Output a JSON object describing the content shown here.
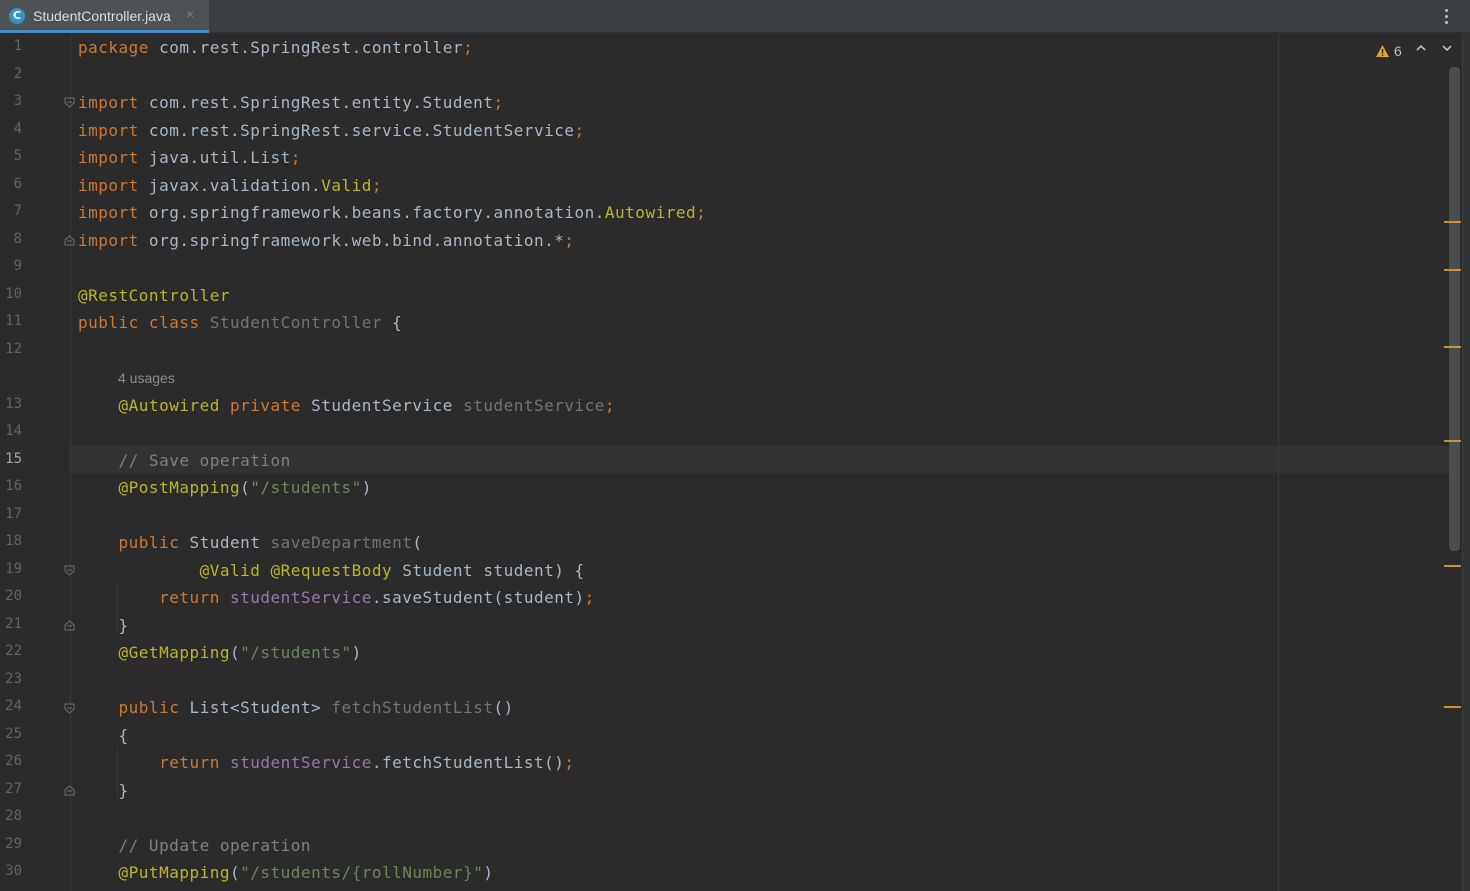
{
  "tab": {
    "title": "StudentController.java",
    "icon_letter": "C",
    "close_glyph": "×"
  },
  "inspections": {
    "warning_count": "6"
  },
  "editor": {
    "current_line": 15,
    "usage_hint": "4 usages",
    "lines": [
      {
        "n": "1",
        "tokens": [
          {
            "t": "package",
            "c": "kw"
          },
          {
            "t": " com.rest.SpringRest.controller",
            "c": "pl"
          },
          {
            "t": ";",
            "c": "kw"
          }
        ]
      },
      {
        "n": "2",
        "tokens": []
      },
      {
        "n": "3",
        "tokens": [
          {
            "t": "import",
            "c": "kw"
          },
          {
            "t": " com.rest.SpringRest.entity.Student",
            "c": "pl"
          },
          {
            "t": ";",
            "c": "kw"
          }
        ]
      },
      {
        "n": "4",
        "tokens": [
          {
            "t": "import",
            "c": "kw"
          },
          {
            "t": " com.rest.SpringRest.service.StudentService",
            "c": "pl"
          },
          {
            "t": ";",
            "c": "kw"
          }
        ]
      },
      {
        "n": "5",
        "tokens": [
          {
            "t": "import",
            "c": "kw"
          },
          {
            "t": " java.util.List",
            "c": "pl"
          },
          {
            "t": ";",
            "c": "kw"
          }
        ]
      },
      {
        "n": "6",
        "tokens": [
          {
            "t": "import",
            "c": "kw"
          },
          {
            "t": " javax.validation.",
            "c": "pl"
          },
          {
            "t": "Valid",
            "c": "ann"
          },
          {
            "t": ";",
            "c": "kw"
          }
        ]
      },
      {
        "n": "7",
        "tokens": [
          {
            "t": "import",
            "c": "kw"
          },
          {
            "t": " org.springframework.beans.factory.annotation.",
            "c": "pl"
          },
          {
            "t": "Autowired",
            "c": "ann"
          },
          {
            "t": ";",
            "c": "kw"
          }
        ]
      },
      {
        "n": "8",
        "tokens": [
          {
            "t": "import",
            "c": "kw"
          },
          {
            "t": " org.springframework.web.bind.annotation.*",
            "c": "pl"
          },
          {
            "t": ";",
            "c": "kw"
          }
        ]
      },
      {
        "n": "9",
        "tokens": []
      },
      {
        "n": "10",
        "tokens": [
          {
            "t": "@RestController",
            "c": "ann"
          }
        ]
      },
      {
        "n": "11",
        "tokens": [
          {
            "t": "public class ",
            "c": "kw"
          },
          {
            "t": "StudentController",
            "c": "unused"
          },
          {
            "t": " {",
            "c": "pl"
          }
        ]
      },
      {
        "n": "12",
        "tokens": []
      },
      {
        "n": "13",
        "tokens": [
          {
            "t": "    ",
            "c": "pl"
          },
          {
            "t": "@Autowired",
            "c": "ann"
          },
          {
            "t": " ",
            "c": "pl"
          },
          {
            "t": "private",
            "c": "kw"
          },
          {
            "t": " StudentService ",
            "c": "pl"
          },
          {
            "t": "studentService",
            "c": "unused"
          },
          {
            "t": ";",
            "c": "kw"
          }
        ]
      },
      {
        "n": "14",
        "tokens": []
      },
      {
        "n": "15",
        "tokens": [
          {
            "t": "    ",
            "c": "pl"
          },
          {
            "t": "// Save operation",
            "c": "com"
          }
        ]
      },
      {
        "n": "16",
        "tokens": [
          {
            "t": "    ",
            "c": "pl"
          },
          {
            "t": "@PostMapping",
            "c": "ann"
          },
          {
            "t": "(",
            "c": "pl"
          },
          {
            "t": "\"/students\"",
            "c": "str"
          },
          {
            "t": ")",
            "c": "pl"
          }
        ]
      },
      {
        "n": "17",
        "tokens": []
      },
      {
        "n": "18",
        "tokens": [
          {
            "t": "    ",
            "c": "pl"
          },
          {
            "t": "public",
            "c": "kw"
          },
          {
            "t": " Student ",
            "c": "pl"
          },
          {
            "t": "saveDepartment",
            "c": "unused"
          },
          {
            "t": "(",
            "c": "pl"
          }
        ]
      },
      {
        "n": "19",
        "tokens": [
          {
            "t": "            ",
            "c": "pl"
          },
          {
            "t": "@Valid",
            "c": "ann"
          },
          {
            "t": " ",
            "c": "pl"
          },
          {
            "t": "@RequestBody",
            "c": "ann"
          },
          {
            "t": " Student student) {",
            "c": "pl"
          }
        ]
      },
      {
        "n": "20",
        "tokens": [
          {
            "t": "        ",
            "c": "pl"
          },
          {
            "t": "return",
            "c": "kw"
          },
          {
            "t": " ",
            "c": "pl"
          },
          {
            "t": "studentService",
            "c": "fld"
          },
          {
            "t": ".saveStudent(student)",
            "c": "pl"
          },
          {
            "t": ";",
            "c": "kw"
          }
        ]
      },
      {
        "n": "21",
        "tokens": [
          {
            "t": "    }",
            "c": "pl"
          }
        ]
      },
      {
        "n": "22",
        "tokens": [
          {
            "t": "    ",
            "c": "pl"
          },
          {
            "t": "@GetMapping",
            "c": "ann"
          },
          {
            "t": "(",
            "c": "pl"
          },
          {
            "t": "\"/students\"",
            "c": "str"
          },
          {
            "t": ")",
            "c": "pl"
          }
        ]
      },
      {
        "n": "23",
        "tokens": []
      },
      {
        "n": "24",
        "tokens": [
          {
            "t": "    ",
            "c": "pl"
          },
          {
            "t": "public",
            "c": "kw"
          },
          {
            "t": " List<Student> ",
            "c": "pl"
          },
          {
            "t": "fetchStudentList",
            "c": "unused"
          },
          {
            "t": "()",
            "c": "pl"
          }
        ]
      },
      {
        "n": "25",
        "tokens": [
          {
            "t": "    {",
            "c": "pl"
          }
        ]
      },
      {
        "n": "26",
        "tokens": [
          {
            "t": "        ",
            "c": "pl"
          },
          {
            "t": "return",
            "c": "kw"
          },
          {
            "t": " ",
            "c": "pl"
          },
          {
            "t": "studentService",
            "c": "fld"
          },
          {
            "t": ".fetchStudentList()",
            "c": "pl"
          },
          {
            "t": ";",
            "c": "kw"
          }
        ]
      },
      {
        "n": "27",
        "tokens": [
          {
            "t": "    }",
            "c": "pl"
          }
        ]
      },
      {
        "n": "28",
        "tokens": []
      },
      {
        "n": "29",
        "tokens": [
          {
            "t": "    ",
            "c": "pl"
          },
          {
            "t": "// Update operation",
            "c": "com"
          }
        ]
      },
      {
        "n": "30",
        "tokens": [
          {
            "t": "    ",
            "c": "pl"
          },
          {
            "t": "@PutMapping",
            "c": "ann"
          },
          {
            "t": "(",
            "c": "pl"
          },
          {
            "t": "\"/students/{rollNumber}\"",
            "c": "str"
          },
          {
            "t": ")",
            "c": "pl"
          }
        ]
      }
    ]
  },
  "colors": {
    "background": "#2b2b2b",
    "keyword": "#cc7832",
    "annotation": "#bbb529",
    "string": "#6a8759",
    "comment": "#808080",
    "field": "#9876aa",
    "warning": "#e0a526"
  }
}
